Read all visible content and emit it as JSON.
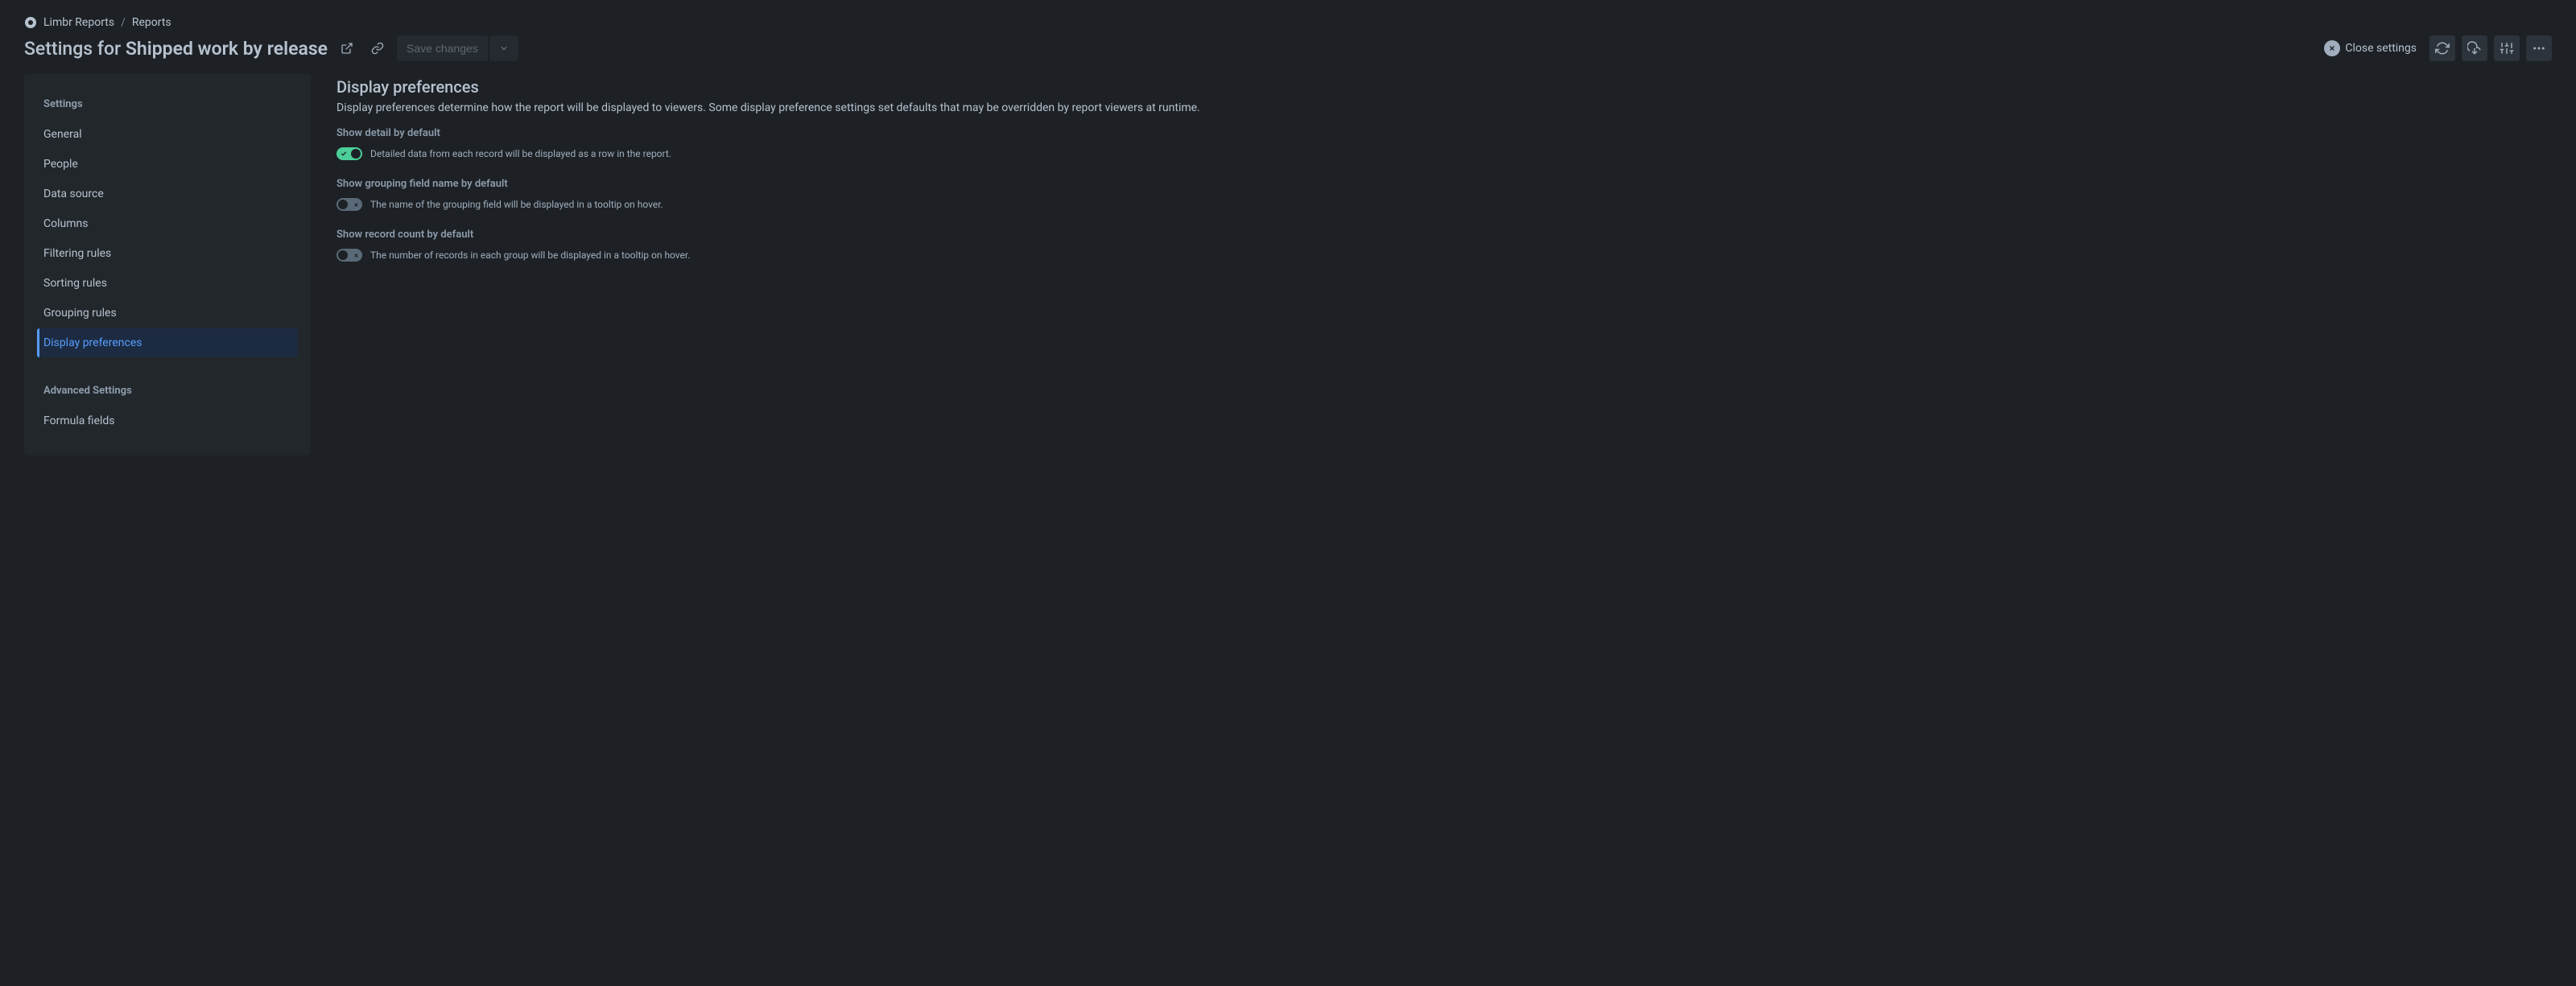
{
  "breadcrumb": {
    "app_name": "Limbr Reports",
    "section": "Reports"
  },
  "page_title_prefix": "Settings for ",
  "page_title_name": "Shipped work by release",
  "toolbar": {
    "save_label": "Save changes",
    "close_label": "Close settings"
  },
  "sidebar": {
    "heading_settings": "Settings",
    "heading_advanced": "Advanced Settings",
    "items": [
      {
        "label": "General"
      },
      {
        "label": "People"
      },
      {
        "label": "Data source"
      },
      {
        "label": "Columns"
      },
      {
        "label": "Filtering rules"
      },
      {
        "label": "Sorting rules"
      },
      {
        "label": "Grouping rules"
      },
      {
        "label": "Display preferences"
      }
    ],
    "advanced_items": [
      {
        "label": "Formula fields"
      }
    ]
  },
  "main": {
    "title": "Display preferences",
    "description": "Display preferences determine how the report will be displayed to viewers. Some display preference settings set defaults that may be overridden by report viewers at runtime.",
    "settings": [
      {
        "label": "Show detail by default",
        "enabled": true,
        "description": "Detailed data from each record will be displayed as a row in the report."
      },
      {
        "label": "Show grouping field name by default",
        "enabled": false,
        "description": "The name of the grouping field will be displayed in a tooltip on hover."
      },
      {
        "label": "Show record count by default",
        "enabled": false,
        "description": "The number of records in each group will be displayed in a tooltip on hover."
      }
    ]
  }
}
